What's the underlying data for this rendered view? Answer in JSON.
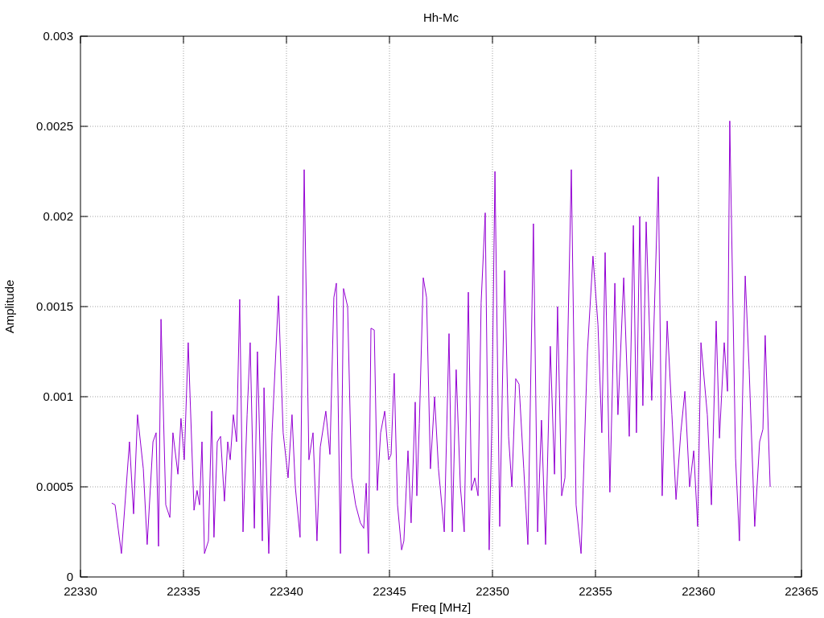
{
  "chart": {
    "chart_data": {
      "type": "line",
      "title": "Hh-Mc",
      "xlabel": "Freq [MHz]",
      "ylabel": "Amplitude",
      "x": [
        22331.52,
        22331.68,
        22331.99,
        22332.38,
        22332.58,
        22332.77,
        22333.05,
        22333.24,
        22333.52,
        22333.67,
        22333.79,
        22333.91,
        22334.14,
        22334.34,
        22334.49,
        22334.73,
        22334.88,
        22335.04,
        22335.23,
        22335.51,
        22335.66,
        22335.78,
        22335.9,
        22336.02,
        22336.21,
        22336.37,
        22336.48,
        22336.64,
        22336.8,
        22336.99,
        22337.15,
        22337.27,
        22337.42,
        22337.58,
        22337.73,
        22337.89,
        22338.09,
        22338.24,
        22338.44,
        22338.59,
        22338.83,
        22338.91,
        22339.14,
        22339.3,
        22339.61,
        22339.84,
        22340.08,
        22340.27,
        22340.43,
        22340.66,
        22340.86,
        22341.09,
        22341.29,
        22341.48,
        22341.64,
        22341.91,
        22342.11,
        22342.3,
        22342.42,
        22342.62,
        22342.77,
        22342.97,
        22343.16,
        22343.36,
        22343.59,
        22343.75,
        22343.87,
        22343.98,
        22344.1,
        22344.26,
        22344.41,
        22344.57,
        22344.77,
        22344.96,
        22345.08,
        22345.23,
        22345.39,
        22345.59,
        22345.7,
        22345.9,
        22346.05,
        22346.25,
        22346.33,
        22346.45,
        22346.64,
        22346.8,
        22346.99,
        22347.19,
        22347.38,
        22347.66,
        22347.89,
        22348.05,
        22348.24,
        22348.44,
        22348.63,
        22348.83,
        22348.98,
        22349.14,
        22349.3,
        22349.45,
        22349.65,
        22349.84,
        22349.96,
        22350.12,
        22350.35,
        22350.59,
        22350.78,
        22350.94,
        22351.13,
        22351.29,
        22351.52,
        22351.72,
        22351.99,
        22352.19,
        22352.38,
        22352.58,
        22352.81,
        22353.01,
        22353.16,
        22353.36,
        22353.52,
        22353.83,
        22354.06,
        22354.3,
        22354.61,
        22354.88,
        22355.12,
        22355.31,
        22355.47,
        22355.7,
        22355.94,
        22356.09,
        22356.37,
        22356.64,
        22356.84,
        22356.99,
        22357.15,
        22357.3,
        22357.46,
        22357.73,
        22358.05,
        22358.24,
        22358.48,
        22358.71,
        22358.91,
        22359.14,
        22359.34,
        22359.57,
        22359.77,
        22359.96,
        22360.12,
        22360.43,
        22360.63,
        22360.86,
        22361.02,
        22361.25,
        22361.41,
        22361.52,
        22361.8,
        22361.99,
        22362.27,
        22362.46,
        22362.73,
        22362.97,
        22363.13,
        22363.24,
        22363.48
      ],
      "series": [
        {
          "color": "#9400d3",
          "values": [
            0.00041,
            0.0004,
            0.00013,
            0.00075,
            0.00035,
            0.0009,
            0.0006,
            0.00018,
            0.00075,
            0.0008,
            0.00017,
            0.00143,
            0.0004,
            0.00033,
            0.0008,
            0.00057,
            0.00088,
            0.00065,
            0.0013,
            0.00037,
            0.00048,
            0.0004,
            0.00075,
            0.00013,
            0.0002,
            0.00092,
            0.00022,
            0.00075,
            0.00078,
            0.00042,
            0.00075,
            0.00065,
            0.0009,
            0.00075,
            0.00154,
            0.00025,
            0.0009,
            0.0013,
            0.00027,
            0.00125,
            0.0002,
            0.00105,
            0.00013,
            0.0008,
            0.00156,
            0.0008,
            0.00055,
            0.0009,
            0.0005,
            0.00022,
            0.00226,
            0.00065,
            0.0008,
            0.0002,
            0.00072,
            0.00092,
            0.00068,
            0.00155,
            0.00163,
            0.00013,
            0.0016,
            0.0015,
            0.00055,
            0.0004,
            0.0003,
            0.00027,
            0.00052,
            0.00013,
            0.00138,
            0.00137,
            0.00048,
            0.0008,
            0.00092,
            0.00065,
            0.00068,
            0.00113,
            0.0004,
            0.00015,
            0.0002,
            0.0007,
            0.0003,
            0.00097,
            0.00045,
            0.00085,
            0.00166,
            0.00155,
            0.0006,
            0.001,
            0.0006,
            0.00025,
            0.00135,
            0.00025,
            0.00115,
            0.0005,
            0.00025,
            0.00158,
            0.00048,
            0.00055,
            0.00045,
            0.00152,
            0.00202,
            0.00015,
            0.0008,
            0.00225,
            0.00028,
            0.0017,
            0.00078,
            0.0005,
            0.0011,
            0.00107,
            0.0006,
            0.00018,
            0.00196,
            0.00025,
            0.00087,
            0.00018,
            0.00128,
            0.00057,
            0.0015,
            0.00045,
            0.00055,
            0.00226,
            0.0004,
            0.00013,
            0.00125,
            0.00178,
            0.0014,
            0.0008,
            0.0018,
            0.00047,
            0.00163,
            0.0009,
            0.00166,
            0.00078,
            0.00195,
            0.0008,
            0.002,
            0.00095,
            0.00197,
            0.00098,
            0.00222,
            0.00045,
            0.00142,
            0.0009,
            0.00043,
            0.0008,
            0.00103,
            0.0005,
            0.0007,
            0.00028,
            0.0013,
            0.0009,
            0.0004,
            0.00142,
            0.00077,
            0.0013,
            0.00103,
            0.00253,
            0.00066,
            0.0002,
            0.00167,
            0.00115,
            0.00028,
            0.00075,
            0.00082,
            0.00134,
            0.0005
          ]
        }
      ],
      "grid": true,
      "xlim": [
        22330,
        22365
      ],
      "ylim": [
        0,
        0.003
      ],
      "xticks": [
        22330,
        22335,
        22340,
        22345,
        22350,
        22355,
        22360,
        22365
      ],
      "yticks": [
        0,
        0.0005,
        0.001,
        0.0015,
        0.002,
        0.0025,
        0.003
      ]
    }
  }
}
